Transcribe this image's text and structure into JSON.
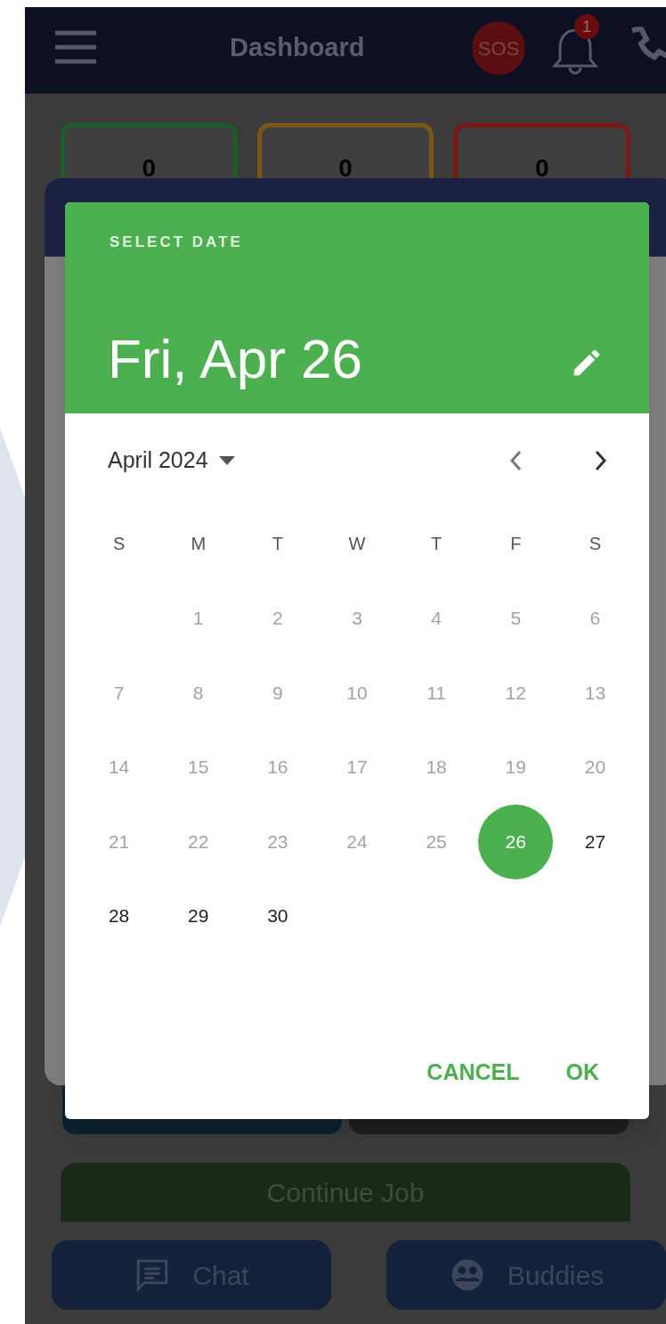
{
  "app_bar": {
    "title": "Dashboard",
    "sos": "SOS",
    "notification_count": "1"
  },
  "stat_cards": [
    {
      "value": "0",
      "color": "#1f5a2a"
    },
    {
      "value": "0",
      "color": "#7a5514"
    },
    {
      "value": "0",
      "color": "#7a1a16"
    }
  ],
  "date_picker": {
    "heading": "SELECT DATE",
    "selected_date": "Fri, Apr 26",
    "month": "April 2024",
    "weekdays": [
      "S",
      "M",
      "T",
      "W",
      "T",
      "F",
      "S"
    ],
    "weeks": [
      [
        {
          "day": "1",
          "disabled": true,
          "selected": false
        },
        {
          "day": "2",
          "disabled": true,
          "selected": false
        },
        {
          "day": "3",
          "disabled": true,
          "selected": false
        },
        {
          "day": "4",
          "disabled": true,
          "selected": false
        },
        {
          "day": "5",
          "disabled": true,
          "selected": false
        },
        {
          "day": "6",
          "disabled": true,
          "selected": false
        }
      ],
      [
        {
          "day": "7",
          "disabled": true,
          "selected": false
        },
        {
          "day": "8",
          "disabled": true,
          "selected": false
        },
        {
          "day": "9",
          "disabled": true,
          "selected": false
        },
        {
          "day": "10",
          "disabled": true,
          "selected": false
        },
        {
          "day": "11",
          "disabled": true,
          "selected": false
        },
        {
          "day": "12",
          "disabled": true,
          "selected": false
        },
        {
          "day": "13",
          "disabled": true,
          "selected": false
        }
      ],
      [
        {
          "day": "14",
          "disabled": true,
          "selected": false
        },
        {
          "day": "15",
          "disabled": true,
          "selected": false
        },
        {
          "day": "16",
          "disabled": true,
          "selected": false
        },
        {
          "day": "17",
          "disabled": true,
          "selected": false
        },
        {
          "day": "18",
          "disabled": true,
          "selected": false
        },
        {
          "day": "19",
          "disabled": true,
          "selected": false
        },
        {
          "day": "20",
          "disabled": true,
          "selected": false
        }
      ],
      [
        {
          "day": "21",
          "disabled": true,
          "selected": false
        },
        {
          "day": "22",
          "disabled": true,
          "selected": false
        },
        {
          "day": "23",
          "disabled": true,
          "selected": false
        },
        {
          "day": "24",
          "disabled": true,
          "selected": false
        },
        {
          "day": "25",
          "disabled": true,
          "selected": false
        },
        {
          "day": "26",
          "disabled": false,
          "selected": true
        },
        {
          "day": "27",
          "disabled": false,
          "selected": false
        }
      ],
      [
        {
          "day": "28",
          "disabled": false,
          "selected": false
        },
        {
          "day": "29",
          "disabled": false,
          "selected": false
        },
        {
          "day": "30",
          "disabled": false,
          "selected": false
        }
      ]
    ],
    "actions": [
      "CANCEL",
      "OK"
    ]
  },
  "continue_button": "Continue Job",
  "bottom_buttons": [
    "Chat",
    "Buddies"
  ]
}
